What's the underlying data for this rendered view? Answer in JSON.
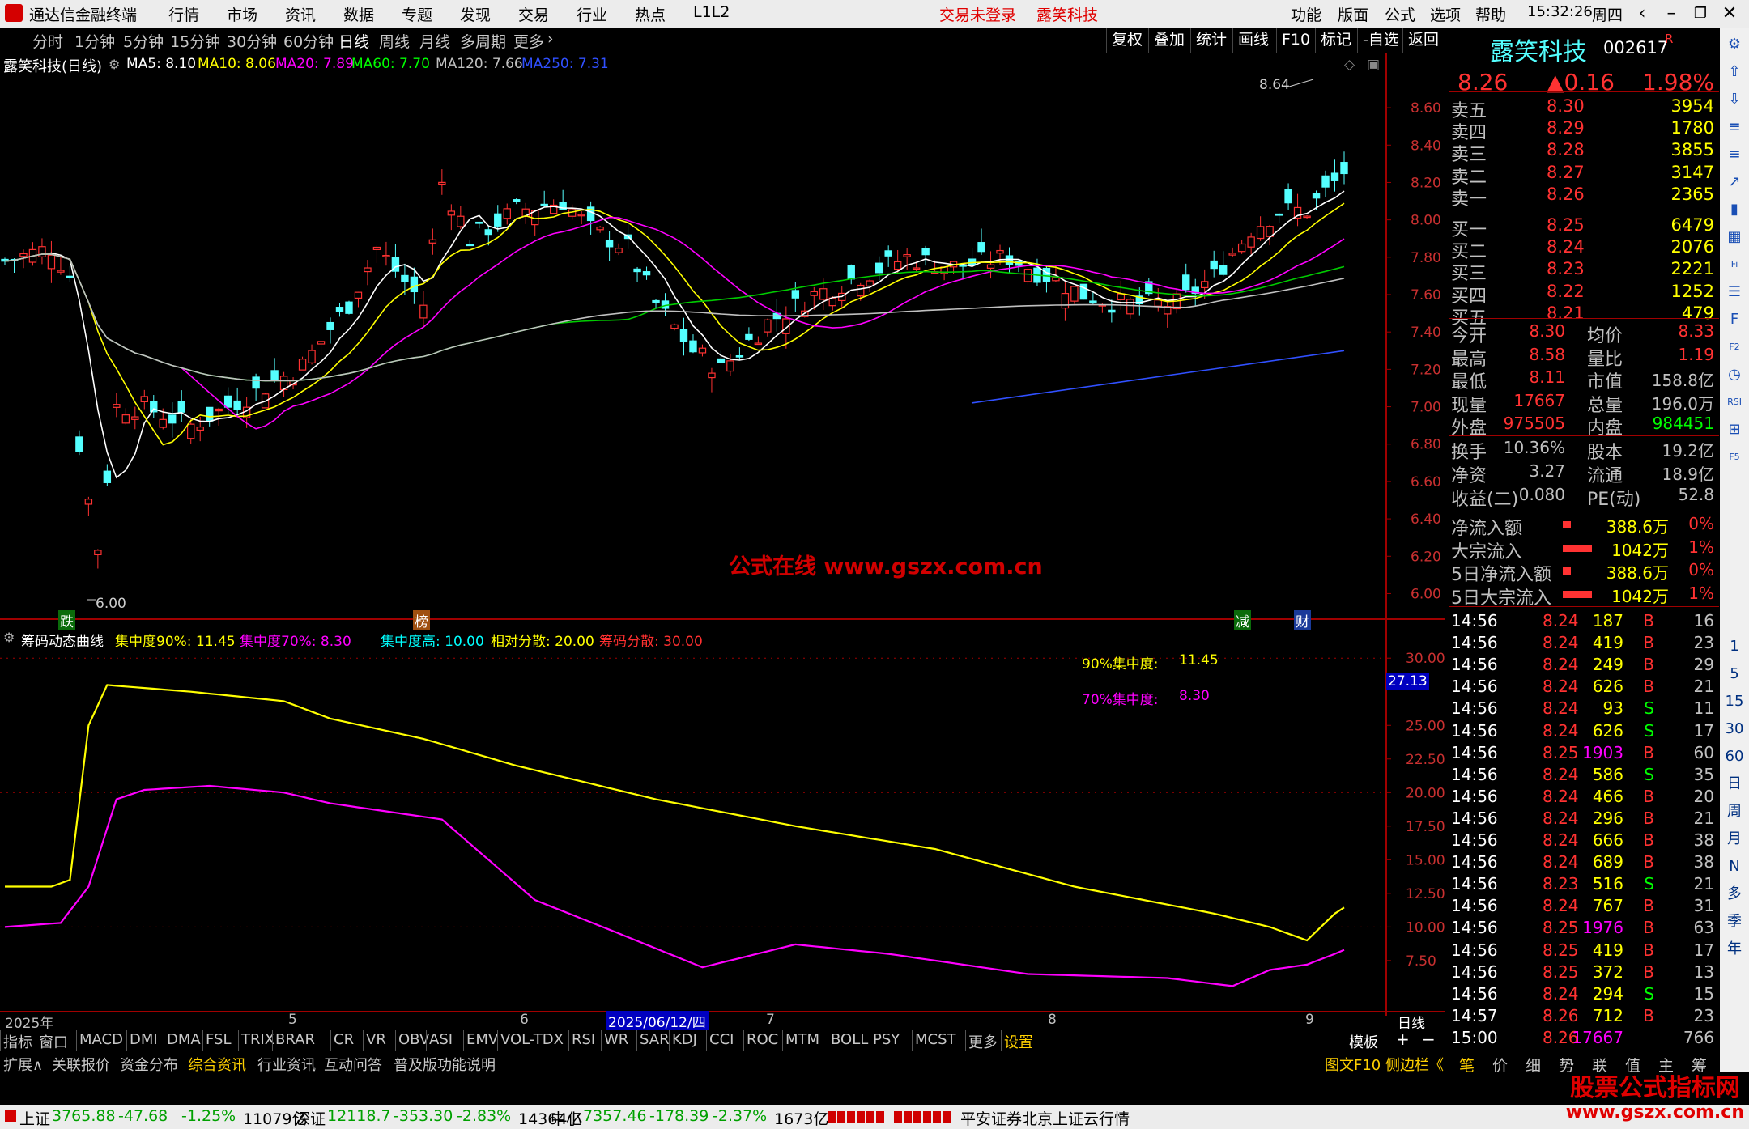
{
  "app": {
    "title": "通达信金融终端",
    "login_status": "交易未登录",
    "stock_name_red": "露笑科技",
    "menu": [
      "行情",
      "市场",
      "资讯",
      "数据",
      "专题",
      "发现",
      "交易",
      "行业",
      "热点",
      "L1L2"
    ],
    "right_menu": [
      "功能",
      "版面",
      "公式",
      "选项",
      "帮助"
    ],
    "time": "15:32:26",
    "weekday": "周四"
  },
  "periods": [
    "分时",
    "1分钟",
    "5分钟",
    "15分钟",
    "30分钟",
    "60分钟",
    "日线",
    "周线",
    "月线",
    "多周期",
    "更多"
  ],
  "selected_period": "日线",
  "tools": [
    "复权",
    "叠加",
    "统计",
    "画线",
    "F10",
    "标记",
    "-自选",
    "返回"
  ],
  "main_chart": {
    "title": "露笑科技(日线)",
    "ma_labels": [
      {
        "text": "MA5: 8.10",
        "color": "#ffffff"
      },
      {
        "text": "MA10: 8.06",
        "color": "#ffff00"
      },
      {
        "text": "MA20: 7.89",
        "color": "#ff00ff"
      },
      {
        "text": "MA60: 7.70",
        "color": "#00ff00"
      },
      {
        "text": "MA120: 7.66",
        "color": "#c0c0c0"
      },
      {
        "text": "MA250: 7.31",
        "color": "#3050ff"
      }
    ],
    "y_ticks": [
      "8.60",
      "8.40",
      "8.20",
      "8.00",
      "7.80",
      "7.60",
      "7.40",
      "7.20",
      "7.00",
      "6.80",
      "6.60",
      "6.40",
      "6.20",
      "6.00"
    ],
    "high_label": "8.64",
    "low_label": "6.00",
    "markers": [
      "跌",
      "榜",
      "减",
      "财"
    ],
    "watermark": "公式在线 www.gszx.com.cn"
  },
  "indicator": {
    "title": "筹码动态曲线",
    "labels": [
      {
        "text": "集中度90%: 11.45",
        "color": "#ffff00"
      },
      {
        "text": "集中度70%: 8.30",
        "color": "#ff00ff"
      },
      {
        "text": "集中度高: 10.00",
        "color": "#00ffff"
      },
      {
        "text": "相对分散: 20.00",
        "color": "#ffff00"
      },
      {
        "text": "筹码分散: 30.00",
        "color": "#ff3030"
      }
    ],
    "y_ticks": [
      "30.00",
      "25.00",
      "22.50",
      "20.00",
      "17.50",
      "15.00",
      "12.50",
      "10.00",
      "7.50"
    ],
    "current_value": "27.13",
    "note90_label": "90%集中度:",
    "note90_value": "11.45",
    "note70_label": "70%集中度:",
    "note70_value": "8.30"
  },
  "x_axis": {
    "labels": [
      "2025年",
      "5",
      "6",
      "7",
      "8",
      "9"
    ],
    "cursor_date": "2025/06/12/四",
    "period": "日线"
  },
  "indicator_tabs": [
    "指标",
    "窗口",
    "MACD",
    "DMI",
    "DMA",
    "FSL",
    "TRIX",
    "BRAR",
    "CR",
    "VR",
    "OBV",
    "ASI",
    "EMV",
    "VOL-TDX",
    "RSI",
    "WR",
    "SAR",
    "KDJ",
    "CCI",
    "ROC",
    "MTM",
    "BOLL",
    "PSY",
    "MCST",
    "更多",
    "设置"
  ],
  "template_btn": "模板",
  "ext_tabs": [
    "扩展∧",
    "关联报价",
    "资金分布",
    "综合资讯",
    "行业资讯",
    "互动问答",
    "普及版功能说明"
  ],
  "ext_right": "图文F10 侧边栏《",
  "quote": {
    "name": "露笑科技",
    "code": "002617",
    "flag": "R",
    "price": "8.26",
    "change": "▲0.16",
    "pct": "1.98%",
    "asks": [
      [
        "卖五",
        "8.30",
        "3954"
      ],
      [
        "卖四",
        "8.29",
        "1780"
      ],
      [
        "卖三",
        "8.28",
        "3855"
      ],
      [
        "卖二",
        "8.27",
        "3147"
      ],
      [
        "卖一",
        "8.26",
        "2365"
      ]
    ],
    "bids": [
      [
        "买一",
        "8.25",
        "6479"
      ],
      [
        "买二",
        "8.24",
        "2076"
      ],
      [
        "买三",
        "8.23",
        "2221"
      ],
      [
        "买四",
        "8.22",
        "1252"
      ],
      [
        "买五",
        "8.21",
        "479"
      ]
    ],
    "stats": [
      [
        "今开",
        "8.30",
        "均价",
        "8.33"
      ],
      [
        "最高",
        "8.58",
        "量比",
        "1.19"
      ],
      [
        "最低",
        "8.11",
        "市值",
        "158.8亿"
      ],
      [
        "现量",
        "17667",
        "总量",
        "196.0万"
      ],
      [
        "外盘",
        "975505",
        "内盘",
        "984451"
      ]
    ],
    "stats2": [
      [
        "换手",
        "10.36%",
        "股本",
        "19.2亿"
      ],
      [
        "净资",
        "3.27",
        "流通",
        "18.9亿"
      ],
      [
        "收益(二)",
        "0.080",
        "PE(动)",
        "52.8"
      ]
    ],
    "flows": [
      [
        "净流入额",
        "388.6万",
        "0%"
      ],
      [
        "大宗流入",
        "1042万",
        "1%"
      ],
      [
        "5日净流入额",
        "388.6万",
        "0%"
      ],
      [
        "5日大宗流入",
        "1042万",
        "1%"
      ]
    ],
    "ticks": [
      [
        "14:56",
        "8.24",
        "187",
        "B",
        "16"
      ],
      [
        "14:56",
        "8.24",
        "419",
        "B",
        "23"
      ],
      [
        "14:56",
        "8.24",
        "249",
        "B",
        "29"
      ],
      [
        "14:56",
        "8.24",
        "626",
        "B",
        "21"
      ],
      [
        "14:56",
        "8.24",
        "93",
        "S",
        "11"
      ],
      [
        "14:56",
        "8.24",
        "626",
        "S",
        "17"
      ],
      [
        "14:56",
        "8.25",
        "1903",
        "B",
        "60"
      ],
      [
        "14:56",
        "8.24",
        "586",
        "S",
        "35"
      ],
      [
        "14:56",
        "8.24",
        "466",
        "B",
        "20"
      ],
      [
        "14:56",
        "8.24",
        "296",
        "B",
        "21"
      ],
      [
        "14:56",
        "8.24",
        "666",
        "B",
        "38"
      ],
      [
        "14:56",
        "8.24",
        "689",
        "B",
        "38"
      ],
      [
        "14:56",
        "8.23",
        "516",
        "S",
        "21"
      ],
      [
        "14:56",
        "8.24",
        "767",
        "B",
        "31"
      ],
      [
        "14:56",
        "8.25",
        "1976",
        "B",
        "63"
      ],
      [
        "14:56",
        "8.25",
        "419",
        "B",
        "17"
      ],
      [
        "14:56",
        "8.25",
        "372",
        "B",
        "13"
      ],
      [
        "14:56",
        "8.24",
        "294",
        "S",
        "15"
      ],
      [
        "14:57",
        "8.26",
        "712",
        "B",
        "23"
      ],
      [
        "15:00",
        "8.26",
        "17667",
        "",
        "766"
      ]
    ],
    "tabs": [
      "笔",
      "价",
      "细",
      "势",
      "联",
      "值",
      "主",
      "筹"
    ]
  },
  "sidebar_icons": [
    "gear-icon",
    "up-arrow-icon",
    "down-arrow-icon",
    "list-icon",
    "list-icon",
    "chart-icon",
    "candle-icon",
    "grid-icon",
    "fi-icon",
    "news-icon",
    "f10-icon",
    "f2-icon",
    "clock-icon",
    "rsi-icon",
    "sq-icon",
    "f5-icon"
  ],
  "sidebar_text": [
    "1",
    "5",
    "15",
    "30",
    "60",
    "日",
    "周",
    "月",
    "N",
    "多",
    "季",
    "年"
  ],
  "status": {
    "idx": [
      {
        "name": "上证",
        "val": "3765.88",
        "chg": "-47.68",
        "pct": "-1.25%",
        "amt": "11079亿"
      },
      {
        "name": "深证",
        "val": "12118.7",
        "chg": "-353.30",
        "pct": "-2.83%",
        "amt": "14364亿"
      },
      {
        "name": "中小",
        "val": "7357.46",
        "chg": "-178.39",
        "pct": "-2.37%",
        "amt": "1673亿"
      }
    ],
    "broker": "平安证券北京上证云行情"
  },
  "brand": {
    "line1": "股票公式指标网",
    "line2": "www.gszx.com.cn"
  }
}
